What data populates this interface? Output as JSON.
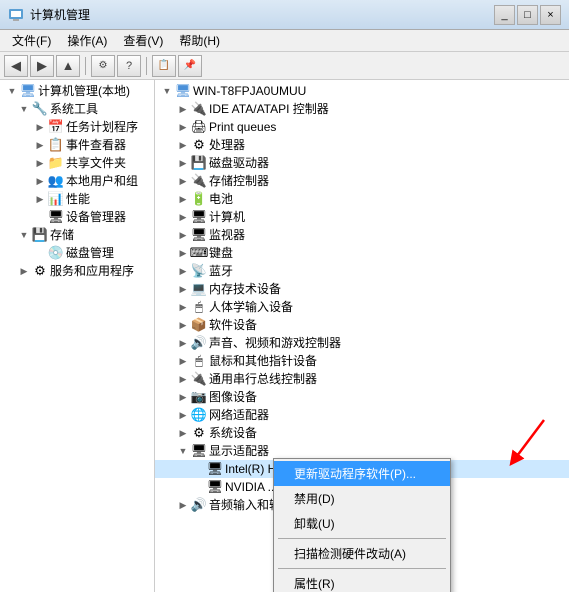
{
  "window": {
    "title": "计算机管理",
    "titlebar_btns": [
      "_",
      "□",
      "×"
    ]
  },
  "menu": {
    "items": [
      "文件(F)",
      "操作(A)",
      "查看(V)",
      "帮助(H)"
    ]
  },
  "toolbar": {
    "buttons": [
      "←",
      "→",
      "↑",
      "🗑",
      "?",
      "📋"
    ]
  },
  "left_tree": {
    "root": {
      "label": "计算机管理(本地)",
      "children": [
        {
          "label": "系统工具",
          "expanded": true,
          "children": [
            {
              "label": "任务计划程序",
              "icon": "📅"
            },
            {
              "label": "事件查看器",
              "icon": "📋"
            },
            {
              "label": "共享文件夹",
              "icon": "📁"
            },
            {
              "label": "本地用户和组",
              "icon": "👥"
            },
            {
              "label": "性能",
              "icon": "📊"
            },
            {
              "label": "设备管理器",
              "icon": "🖥"
            }
          ]
        },
        {
          "label": "存储",
          "expanded": true,
          "children": [
            {
              "label": "磁盘管理",
              "icon": "💾"
            }
          ]
        },
        {
          "label": "服务和应用程序",
          "icon": "⚙"
        }
      ]
    }
  },
  "right_tree": {
    "root": "WIN-T8FPJA0UMUU",
    "items": [
      {
        "label": "IDE ATA/ATAPI 控制器",
        "expanded": false
      },
      {
        "label": "Print queues",
        "expanded": false
      },
      {
        "label": "处理器",
        "expanded": false
      },
      {
        "label": "磁盘驱动器",
        "expanded": false
      },
      {
        "label": "存储控制器",
        "expanded": false
      },
      {
        "label": "电池",
        "expanded": false
      },
      {
        "label": "计算机",
        "expanded": false
      },
      {
        "label": "监视器",
        "expanded": false
      },
      {
        "label": "键盘",
        "expanded": false
      },
      {
        "label": "蓝牙",
        "expanded": false
      },
      {
        "label": "内存技术设备",
        "expanded": false
      },
      {
        "label": "人体学输入设备",
        "expanded": false
      },
      {
        "label": "软件设备",
        "expanded": false
      },
      {
        "label": "声音、视频和游戏控制器",
        "expanded": false
      },
      {
        "label": "鼠标和其他指针设备",
        "expanded": false
      },
      {
        "label": "通用串行总线控制器",
        "expanded": false
      },
      {
        "label": "图像设备",
        "expanded": false
      },
      {
        "label": "网络适配器",
        "expanded": false
      },
      {
        "label": "系统设备",
        "expanded": false
      },
      {
        "label": "显示适配器",
        "expanded": true,
        "children": [
          {
            "label": "Intel(R) HD G..."
          },
          {
            "label": "NVIDIA ..."
          }
        ]
      },
      {
        "label": "音频输入和输..."
      }
    ]
  },
  "context_menu": {
    "items": [
      {
        "label": "更新驱动程序软件(P)...",
        "highlight": true
      },
      {
        "label": "禁用(D)",
        "highlight": false
      },
      {
        "label": "卸载(U)",
        "highlight": false
      },
      {
        "sep": true
      },
      {
        "label": "扫描检测硬件改动(A)",
        "highlight": false
      },
      {
        "sep": true
      },
      {
        "label": "属性(R)",
        "highlight": false
      }
    ]
  }
}
